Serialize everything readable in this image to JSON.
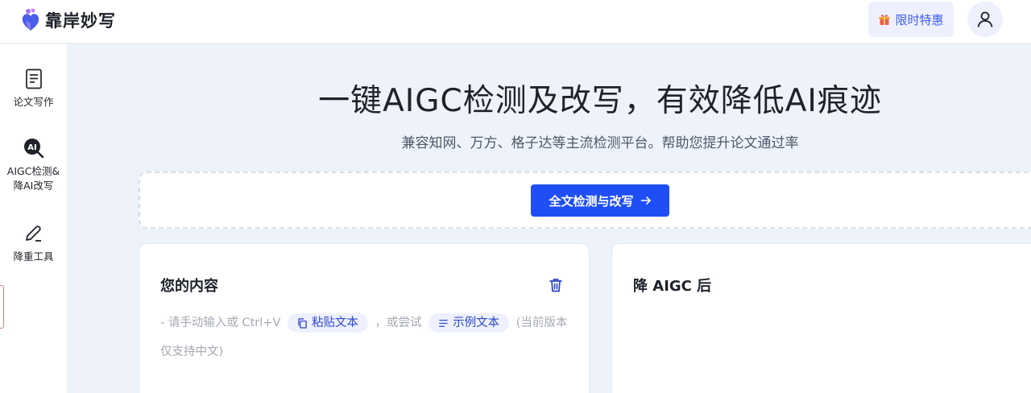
{
  "app": {
    "name": "靠岸妙写",
    "promo_label": "限时特惠"
  },
  "sidebar": {
    "items": [
      {
        "label": "论文写作",
        "icon": "document-icon"
      },
      {
        "label_line1": "AIGC检测&",
        "label_line2": "降AI改写",
        "icon": "ai-search-icon"
      },
      {
        "label": "降重工具",
        "icon": "pen-icon"
      }
    ]
  },
  "hero": {
    "title": "一键AIGC检测及改写，有效降低AI痕迹",
    "subtitle": "兼容知网、万方、格子达等主流检测平台。帮助您提升论文通过率",
    "primary_button": "全文检测与改写"
  },
  "input_card": {
    "title": "您的内容",
    "hint_prefix": "- 请手动输入或 Ctrl+V",
    "paste_chip": "粘贴文本",
    "hint_mid": "，或尝试",
    "example_chip": "示例文本",
    "hint_suffix": "(当前版本仅支持中文)"
  },
  "output_card": {
    "title": "降 AIGC 后"
  },
  "colors": {
    "accent": "#1f4ef5",
    "chip_bg": "#eef1fd",
    "page_bg": "#eef2fb"
  }
}
